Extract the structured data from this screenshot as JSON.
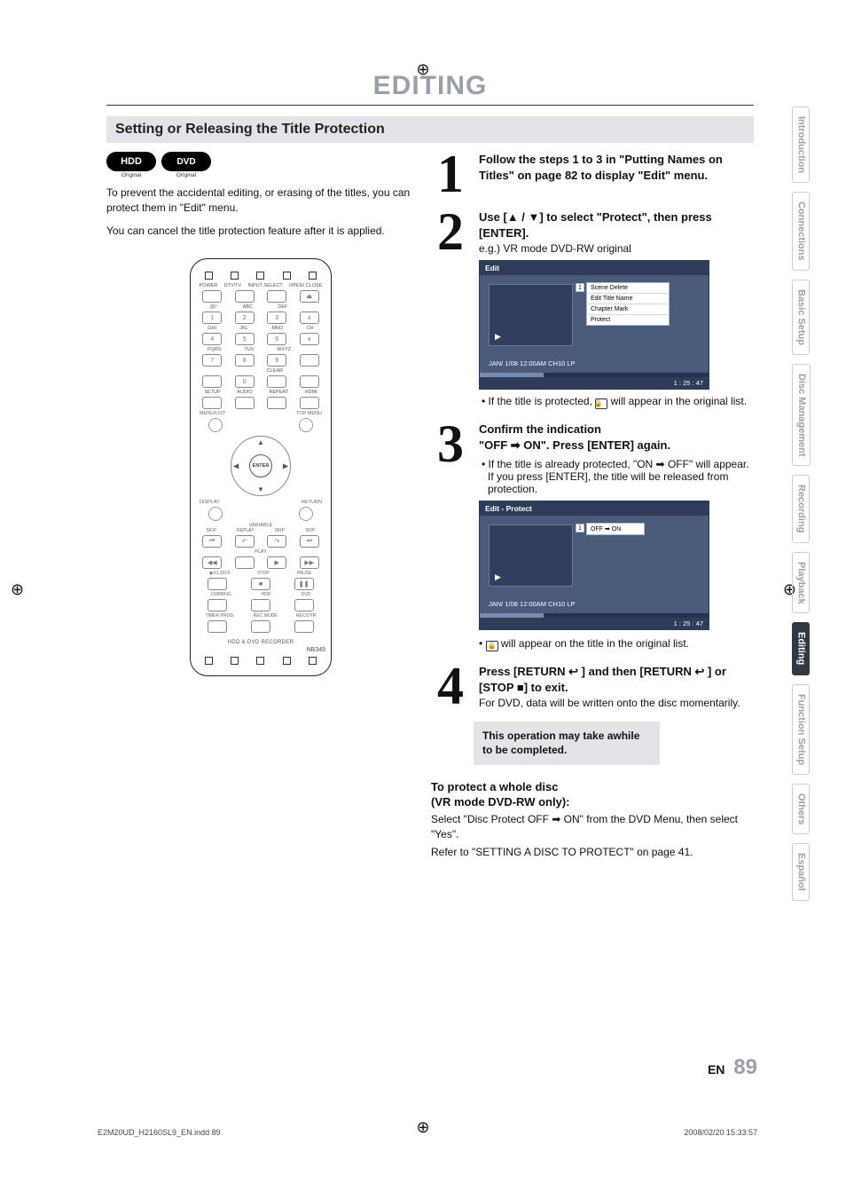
{
  "title": "EDITING",
  "section": "Setting or Releasing the Title Protection",
  "badges": {
    "hdd": "HDD",
    "hdd_sub": "Original",
    "dvd": "DVD",
    "dvd_sub2": "Original"
  },
  "intro1": "To prevent the accidental editing, or erasing of the titles, you can protect them in \"Edit\" menu.",
  "intro2": "You can cancel the title protection feature after it is applied.",
  "remote": {
    "row_labels1": [
      "POWER",
      "DTV/TV",
      "INPUT SELECT",
      "OPEN/ CLOSE"
    ],
    "row_labels_abc": [
      ".@/:",
      "ABC",
      "DEF",
      ""
    ],
    "row_labels_ghi": [
      "GHI",
      "JKL",
      "MNO",
      "CH"
    ],
    "row_labels_pqrs": [
      "PQRS",
      "TUV",
      "WXYZ",
      ""
    ],
    "clear": "CLEAR",
    "setup_row": [
      "SETUP",
      "AUDIO",
      "REPEAT",
      "HDMI"
    ],
    "menu_row_l": "MENU/LIST",
    "menu_row_r": "TOP MENU",
    "display": "DISPLAY",
    "return": "RETURN",
    "variable": "VARIABLE",
    "skip_l": "SKIP",
    "replay": "REPLAY",
    "skip_mid": "SKIP",
    "skip_r": "SKIP",
    "play": "PLAY",
    "rev": "◀◀",
    "fwd": "▶▶",
    "speed": "▶X1.3/0.8",
    "stop": "STOP",
    "pause": "PAUSE",
    "dubbing": "DUBBING",
    "hdd": "HDD",
    "dvd": "DVD",
    "timer": "TIMER PROG.",
    "recmode": "REC MODE",
    "recotr": "REC/OTR",
    "footer": "HDD & DVD RECORDER",
    "model": "NB345",
    "enter": "ENTER",
    "nums": [
      "1",
      "2",
      "3",
      "4",
      "5",
      "6",
      "7",
      "8",
      "9",
      "0"
    ]
  },
  "step1": {
    "num": "1",
    "text": "Follow the steps 1 to 3 in \"Putting Names on Titles\" on page 82 to display \"Edit\" menu."
  },
  "step2": {
    "num": "2",
    "lead": "Use [▲ / ▼] to select \"Protect\", then press [ENTER].",
    "sub": "e.g.) VR mode DVD-RW original",
    "osd": {
      "title": "Edit",
      "num": "1",
      "menu": [
        "Scene Delete",
        "Edit Title Name",
        "Chapter Mark",
        "Protect"
      ],
      "status": "JAN/ 1/08 12:00AM CH10   LP",
      "time": "1 : 25 : 47"
    },
    "bullet": "If the title is protected,        will appear in the original list.",
    "icon_inline": "🔒"
  },
  "step3": {
    "num": "3",
    "lead1": "Confirm the indication",
    "lead2": "\"OFF ➡ ON\". Press [ENTER] again.",
    "bullet1": "If the title is already protected, \"ON ➡ OFF\" will appear. If you press [ENTER], the title will be released from protection.",
    "osd": {
      "title": "Edit - Protect",
      "num": "1",
      "toggle": "OFF  ➡  ON",
      "status": "JAN/ 1/08 12:00AM CH10   LP",
      "time": "1 : 25 : 47"
    },
    "bullet2_pre": "•",
    "bullet2": "       will appear on the title in the original list."
  },
  "step4": {
    "num": "4",
    "lead": "Press [RETURN ↩ ] and then [RETURN ↩ ] or [STOP ■] to exit.",
    "sub": "For DVD, data will be written onto the disc momentarily.",
    "note": "This operation may take awhile to be completed."
  },
  "whole_disc": {
    "head1": "To protect a whole disc",
    "head2": "(VR mode DVD-RW only):",
    "p1": "Select \"Disc Protect OFF ➡ ON\" from the DVD Menu, then select \"Yes\".",
    "p2": "Refer to \"SETTING A DISC TO PROTECT\" on page 41."
  },
  "tabs": [
    "Introduction",
    "Connections",
    "Basic Setup",
    "Disc Management",
    "Recording",
    "Playback",
    "Editing",
    "Function Setup",
    "Others",
    "Español"
  ],
  "page": {
    "en": "EN",
    "num": "89"
  },
  "footer": {
    "file": "E2M20UD_H2160SL9_EN.indd   89",
    "time": "2008/02/20   15:33:57"
  }
}
